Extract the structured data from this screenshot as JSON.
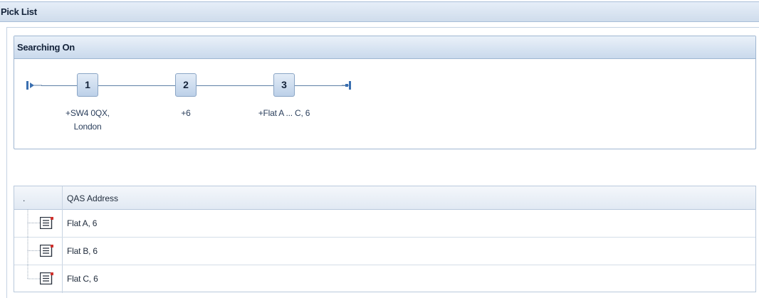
{
  "window": {
    "title": "Pick List"
  },
  "search_panel": {
    "header": "Searching On",
    "start_icon": "start-arrow-icon",
    "end_icon": "end-pin-icon",
    "steps": [
      {
        "number": "1",
        "label_line1": "+SW4 0QX,",
        "label_line2": "London"
      },
      {
        "number": "2",
        "label_line1": "+6",
        "label_line2": ""
      },
      {
        "number": "3",
        "label_line1": "+Flat A ... C, 6",
        "label_line2": ""
      }
    ]
  },
  "grid": {
    "columns": [
      ".",
      "QAS Address"
    ],
    "row_icon": "document-icon",
    "rows": [
      {
        "address": "Flat A, 6"
      },
      {
        "address": "Flat B, 6"
      },
      {
        "address": "Flat C, 6"
      }
    ]
  },
  "colors": {
    "header_gradient_top": "#eaf1f9",
    "header_gradient_bottom": "#c9d9ec",
    "border": "#9fb6d1",
    "accent_red": "#d0312d"
  }
}
